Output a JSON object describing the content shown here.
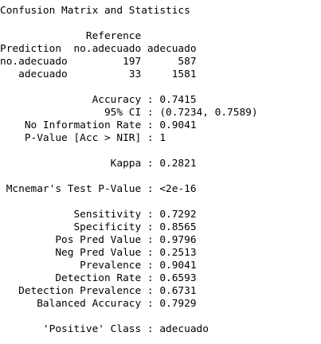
{
  "console": {
    "heading": "Confusion Matrix and Statistics",
    "matrix": {
      "reference_label": "Reference",
      "prediction_label": "Prediction",
      "col_headers": [
        "no.adecuado",
        "adecuado"
      ],
      "rows": [
        {
          "label": "no.adecuado",
          "values": [
            "197",
            "587"
          ]
        },
        {
          "label": "adecuado",
          "values": [
            "33",
            "1581"
          ]
        }
      ]
    },
    "stats_group1": [
      {
        "label": "Accuracy",
        "value": "0.7415"
      },
      {
        "label": "95% CI",
        "value": "(0.7234, 0.7589)"
      },
      {
        "label": "No Information Rate",
        "value": "0.9041"
      },
      {
        "label": "P-Value [Acc > NIR]",
        "value": "1"
      }
    ],
    "kappa": {
      "label": "Kappa",
      "value": "0.2821"
    },
    "mcnemar": {
      "label": "Mcnemar's Test P-Value",
      "value": "<2e-16"
    },
    "stats_group2": [
      {
        "label": "Sensitivity",
        "value": "0.7292"
      },
      {
        "label": "Specificity",
        "value": "0.8565"
      },
      {
        "label": "Pos Pred Value",
        "value": "0.9796"
      },
      {
        "label": "Neg Pred Value",
        "value": "0.2513"
      },
      {
        "label": "Prevalence",
        "value": "0.9041"
      },
      {
        "label": "Detection Rate",
        "value": "0.6593"
      },
      {
        "label": "Detection Prevalence",
        "value": "0.6731"
      },
      {
        "label": "Balanced Accuracy",
        "value": "0.7929"
      }
    ],
    "positive_class": {
      "label": "'Positive' Class",
      "value": "adecuado"
    }
  }
}
